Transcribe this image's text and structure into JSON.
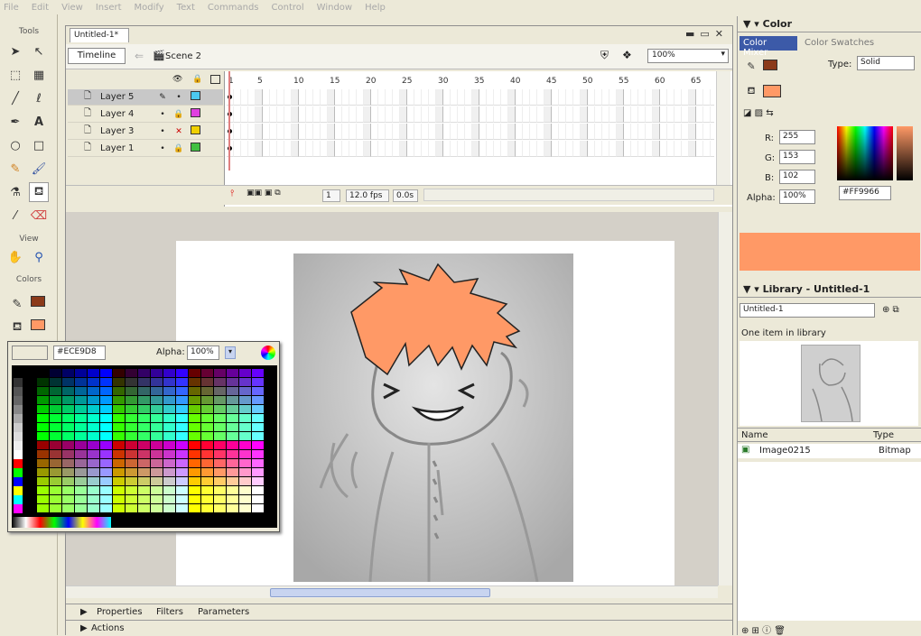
{
  "menu": [
    "File",
    "Edit",
    "View",
    "Insert",
    "Modify",
    "Text",
    "Commands",
    "Control",
    "Window",
    "Help"
  ],
  "tools": {
    "title": "Tools",
    "view_title": "View",
    "colors_title": "Colors",
    "stroke_color": "#8b3a1a",
    "fill_color": "#ff9966"
  },
  "document": {
    "tab": "Untitled-1*",
    "timeline_button": "Timeline",
    "scene": "Scene 2",
    "zoom": "100%",
    "frame_numbers": [
      "1",
      "5",
      "10",
      "15",
      "20",
      "25",
      "30",
      "35",
      "40",
      "45",
      "50",
      "55",
      "60",
      "65"
    ],
    "layers": [
      {
        "name": "Layer 5",
        "active": true
      },
      {
        "name": "Layer 4",
        "active": false
      },
      {
        "name": "Layer 3",
        "active": false
      },
      {
        "name": "Layer 1",
        "active": false
      }
    ],
    "current_frame": "1",
    "fps": "12.0 fps",
    "time": "0.0s",
    "properties_tabs": [
      "Properties",
      "Filters",
      "Parameters"
    ],
    "actions_label": "Actions"
  },
  "picker": {
    "hex": "#ECE9D8",
    "alpha_label": "Alpha:",
    "alpha": "100%"
  },
  "color_panel": {
    "title": "Color",
    "tabs": [
      "Color Mixer",
      "Color Swatches"
    ],
    "type_label": "Type:",
    "type": "Solid",
    "r_label": "R:",
    "r": "255",
    "g_label": "G:",
    "g": "153",
    "b_label": "B:",
    "b": "102",
    "alpha_label": "Alpha:",
    "alpha": "100%",
    "hex": "#FF9966",
    "current": "#ff9966"
  },
  "library": {
    "title": "Library - Untitled-1",
    "doc": "Untitled-1",
    "count": "One item in library",
    "col_name": "Name",
    "col_type": "Type",
    "items": [
      {
        "name": "Image0215",
        "type": "Bitmap"
      }
    ]
  }
}
